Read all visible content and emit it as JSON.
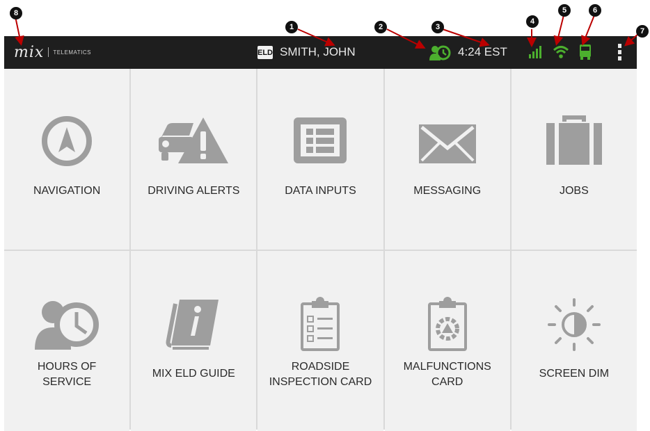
{
  "header": {
    "logo_mark": "mix",
    "logo_text": "TELEMATICS",
    "eld_badge": "ELD",
    "driver_name": "SMITH, JOHN",
    "time": "4:24 EST",
    "status_color": "#4caf2e",
    "icons": [
      "hours-of-service-icon",
      "signal-strength-icon",
      "wifi-icon",
      "truck-icon",
      "overflow-menu-icon"
    ]
  },
  "tiles": [
    {
      "label": "NAVIGATION",
      "icon": "navigation-icon"
    },
    {
      "label": "DRIVING ALERTS",
      "icon": "driving-alerts-icon"
    },
    {
      "label": "DATA INPUTS",
      "icon": "data-inputs-icon"
    },
    {
      "label": "MESSAGING",
      "icon": "envelope-icon"
    },
    {
      "label": "JOBS",
      "icon": "briefcase-icon"
    },
    {
      "label": "HOURS OF\nSERVICE",
      "icon": "hours-of-service-icon"
    },
    {
      "label": "MIX ELD GUIDE",
      "icon": "guide-book-icon"
    },
    {
      "label": "ROADSIDE\nINSPECTION CARD",
      "icon": "inspection-card-icon"
    },
    {
      "label": "MALFUNCTIONS\nCARD",
      "icon": "malfunctions-card-icon"
    },
    {
      "label": "SCREEN DIM",
      "icon": "brightness-icon"
    }
  ],
  "callouts": [
    "1",
    "2",
    "3",
    "4",
    "5",
    "6",
    "7",
    "8"
  ]
}
